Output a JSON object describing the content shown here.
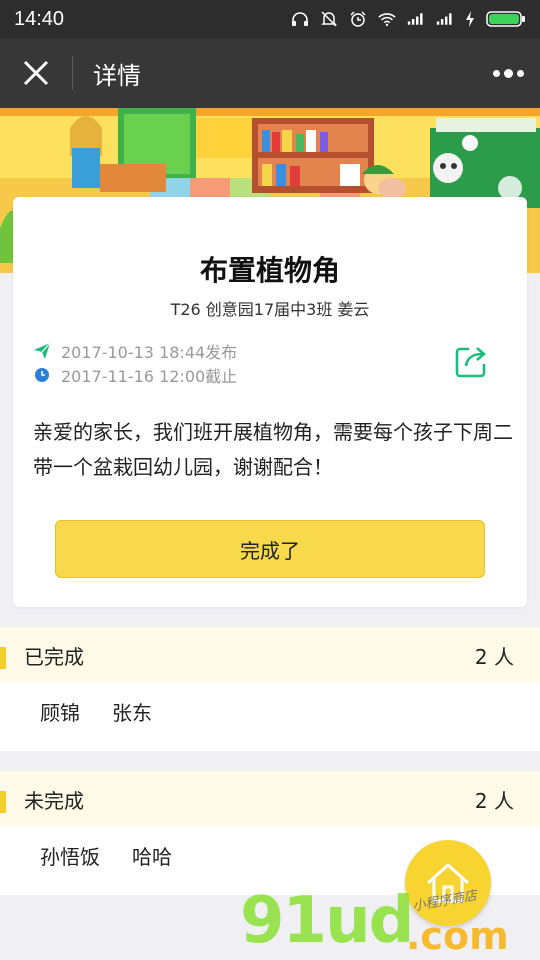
{
  "status_bar": {
    "time": "14:40"
  },
  "nav": {
    "title": "详情"
  },
  "card": {
    "title": "布置植物角",
    "subtitle": "T26 创意园17届中3班 姜云",
    "published": "2017-10-13 18:44发布",
    "deadline": "2017-11-16 12:00截止",
    "content": "亲爱的家长，我们班开展植物角，需要每个孩子下周二带一个盆栽回幼儿园，谢谢配合！",
    "button_label": "完成了"
  },
  "completed": {
    "label": "已完成",
    "count": "2 人",
    "names": [
      "顾锦",
      "张东"
    ]
  },
  "pending": {
    "label": "未完成",
    "count": "2 人",
    "names": [
      "孙悟饭",
      "哈哈"
    ]
  },
  "watermark": {
    "main": "91ud",
    "tld": ".com",
    "sub": "小程序商店"
  },
  "colors": {
    "accent_yellow": "#f7d94b",
    "section_bg": "#fffbe8",
    "send_icon": "#1bbc7d",
    "clock_icon": "#2b7fd9"
  },
  "icons": [
    "close-icon",
    "more-icon",
    "send-icon",
    "clock-icon",
    "share-icon",
    "home-icon"
  ]
}
